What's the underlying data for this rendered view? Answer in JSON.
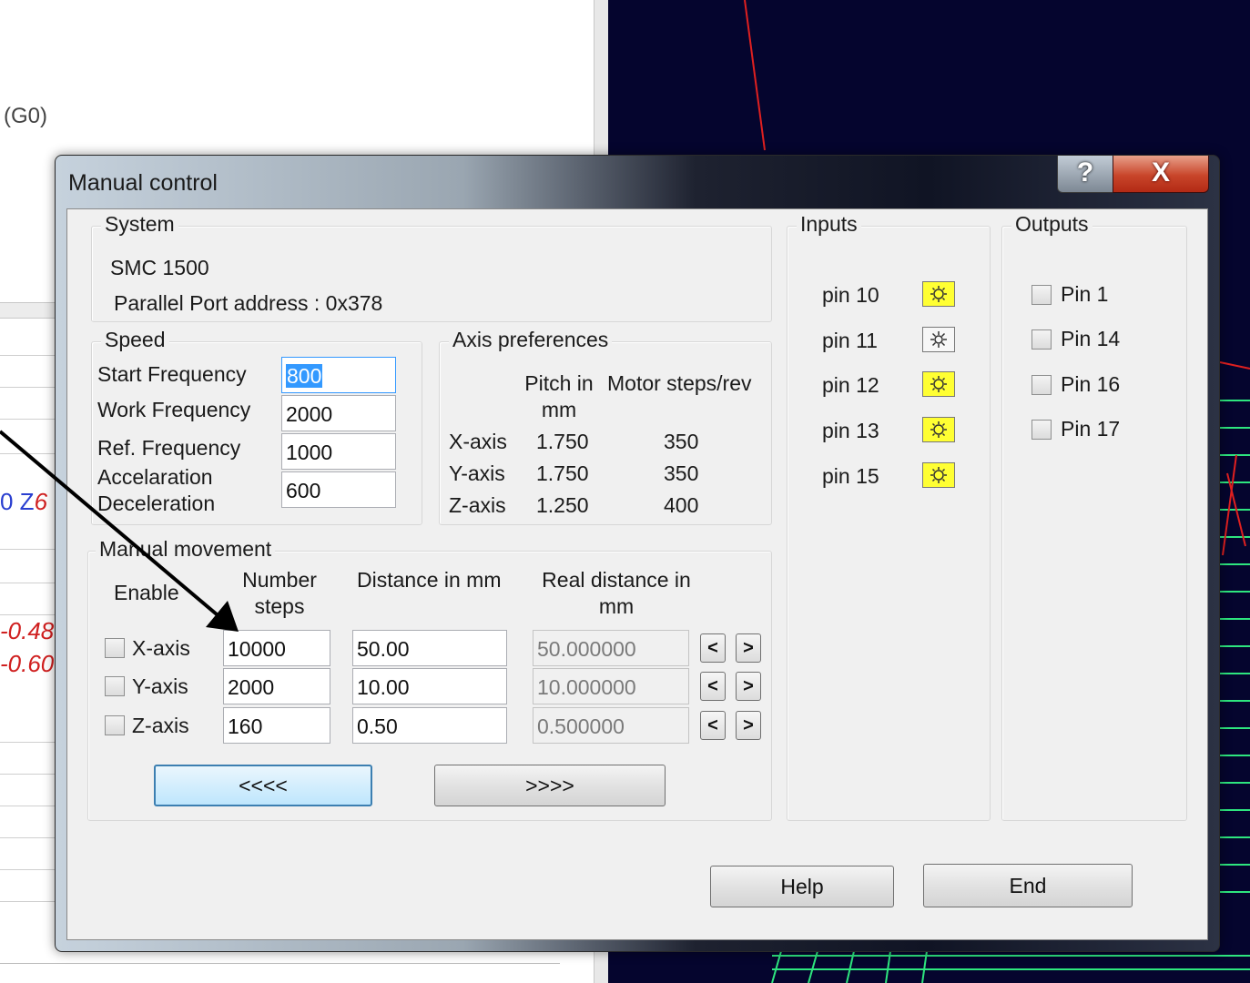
{
  "background": {
    "g0_text": "(G0)",
    "z_text": "0 Z",
    "z_value": "6",
    "red_values": [
      "-0.48",
      "-0.60"
    ]
  },
  "dialog": {
    "title": "Manual control",
    "help_glyph": "?",
    "close_glyph": "X"
  },
  "system": {
    "legend": "System",
    "model": "SMC 1500",
    "port": "Parallel Port address : 0x378"
  },
  "speed": {
    "legend": "Speed",
    "rows": [
      {
        "label": "Start Frequency",
        "value": "800"
      },
      {
        "label": "Work Frequency",
        "value": "2000"
      },
      {
        "label": "Ref. Frequency",
        "value": "1000"
      },
      {
        "label": "Accelaration",
        "value": ""
      },
      {
        "label": "Deceleration",
        "value": "600"
      }
    ]
  },
  "axis_prefs": {
    "legend": "Axis preferences",
    "col_pitch_1": "Pitch in",
    "col_pitch_2": "mm",
    "col_steps": "Motor steps/rev",
    "rows": [
      {
        "axis": "X-axis",
        "pitch": "1.750",
        "steps": "350"
      },
      {
        "axis": "Y-axis",
        "pitch": "1.750",
        "steps": "350"
      },
      {
        "axis": "Z-axis",
        "pitch": "1.250",
        "steps": "400"
      }
    ]
  },
  "manual": {
    "legend": "Manual movement",
    "col_enable": "Enable",
    "col_steps_1": "Number",
    "col_steps_2": "steps",
    "col_distance": "Distance in mm",
    "col_real_1": "Real distance in",
    "col_real_2": "mm",
    "rows": [
      {
        "axis": "X-axis",
        "steps": "10000",
        "distance": "50.00",
        "real": "50.000000"
      },
      {
        "axis": "Y-axis",
        "steps": "2000",
        "distance": "10.00",
        "real": "10.000000"
      },
      {
        "axis": "Z-axis",
        "steps": "160",
        "distance": "0.50",
        "real": "0.500000"
      }
    ],
    "dec_glyph": "<",
    "inc_glyph": ">",
    "back_label": "<<<<",
    "forward_label": ">>>>"
  },
  "inputs": {
    "legend": "Inputs",
    "pins": [
      {
        "label": "pin 10",
        "state": "on"
      },
      {
        "label": "pin 11",
        "state": "off"
      },
      {
        "label": "pin 12",
        "state": "on"
      },
      {
        "label": "pin 13",
        "state": "on"
      },
      {
        "label": "pin 15",
        "state": "on"
      }
    ]
  },
  "outputs": {
    "legend": "Outputs",
    "pins": [
      "Pin 1",
      "Pin 14",
      "Pin 16",
      "Pin 17"
    ]
  },
  "footer": {
    "help_label": "Help",
    "end_label": "End"
  },
  "colors": {
    "led_on": "#ffff33",
    "canvas_bg": "#05052e",
    "focus_border": "#3c7fb1"
  }
}
